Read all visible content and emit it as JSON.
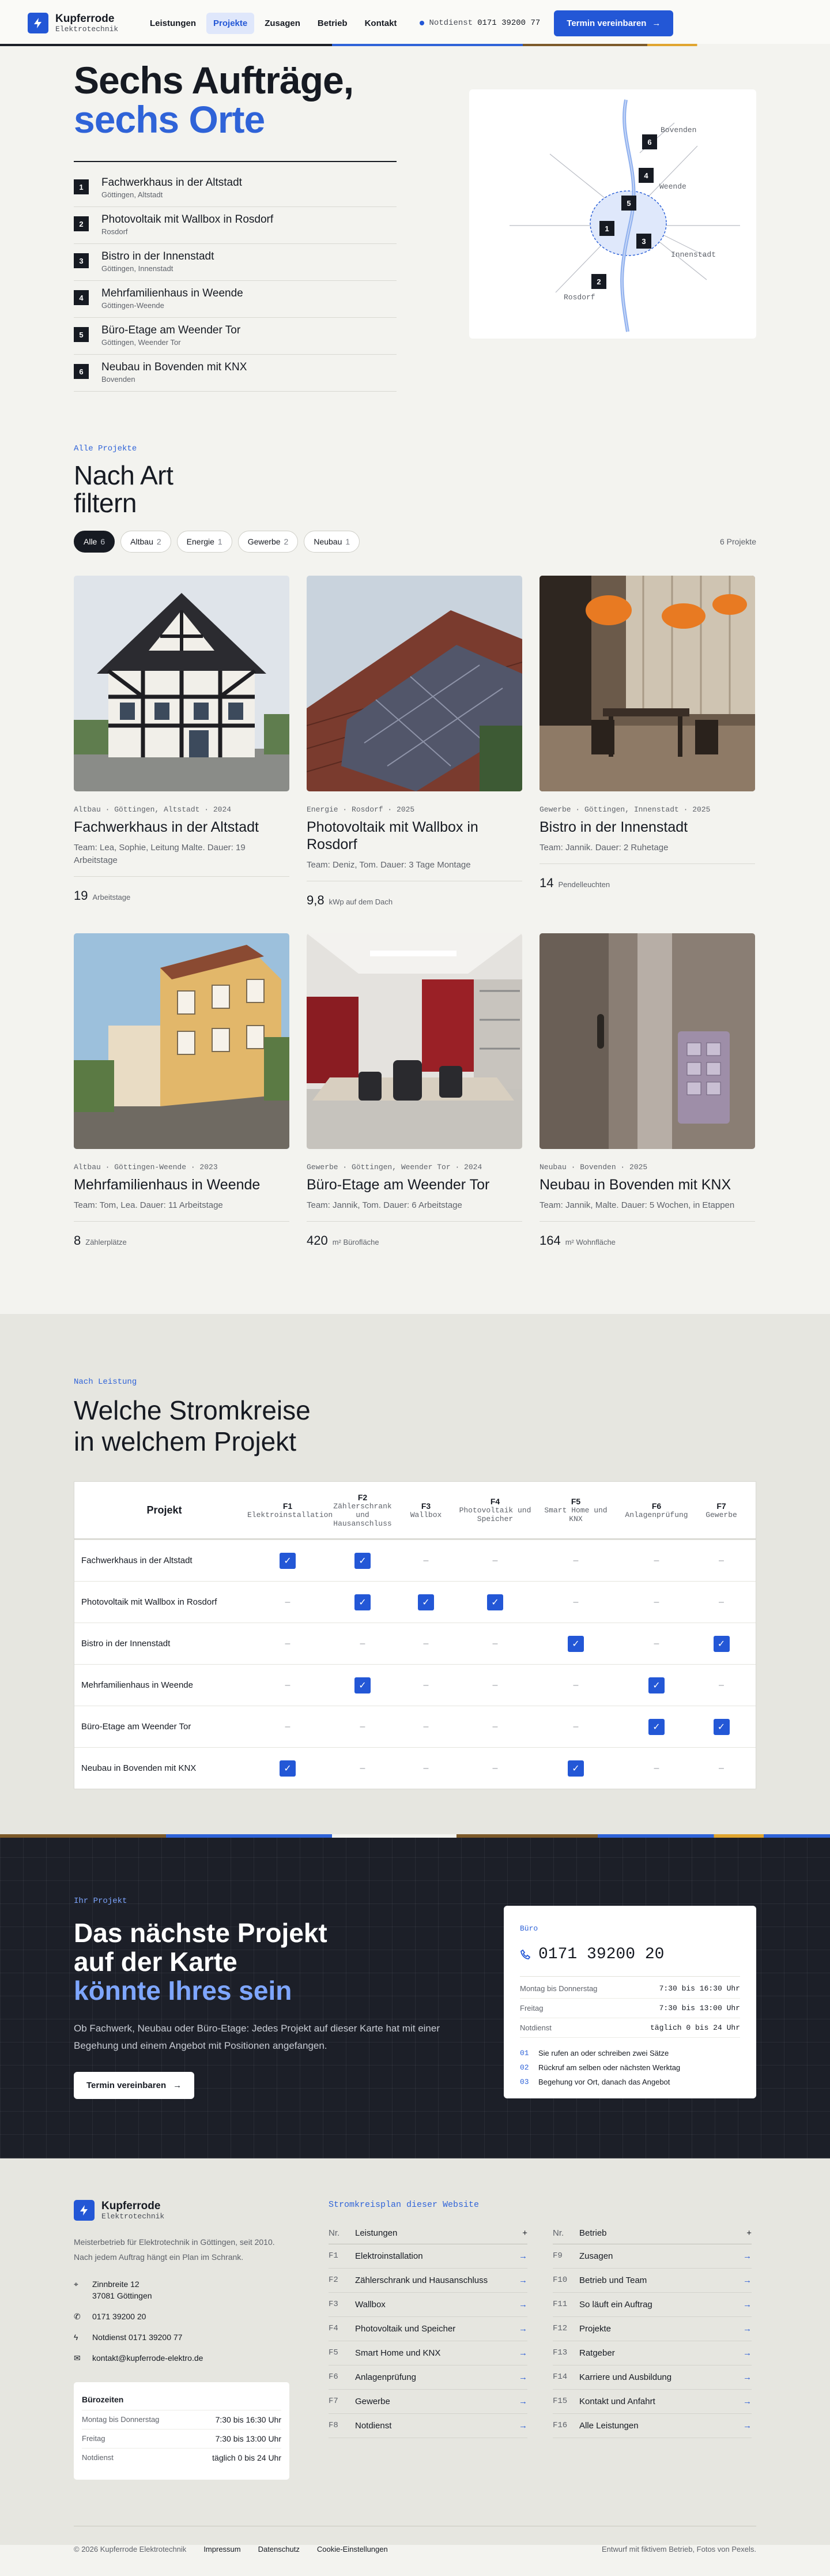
{
  "header": {
    "brand": "Kupferrode",
    "brand_sub": "Elektrotechnik",
    "nav": [
      "Leistungen",
      "Projekte",
      "Zusagen",
      "Betrieb",
      "Kontakt"
    ],
    "emergency_label": "Notdienst",
    "emergency_phone": "0171 39200 77",
    "cta": "Termin vereinbaren",
    "cta_icon": "arrow-right-icon"
  },
  "hero": {
    "title_1": "Sechs Aufträge,",
    "title_2": "sechs Orte",
    "projects": [
      {
        "no": "1",
        "title": "Fachwerkhaus in der Altstadt",
        "place": "Göttingen, Altstadt"
      },
      {
        "no": "2",
        "title": "Photovoltaik mit Wallbox in Rosdorf",
        "place": "Rosdorf"
      },
      {
        "no": "3",
        "title": "Bistro in der Innenstadt",
        "place": "Göttingen, Innenstadt"
      },
      {
        "no": "4",
        "title": "Mehrfamilienhaus in Weende",
        "place": "Göttingen-Weende"
      },
      {
        "no": "5",
        "title": "Büro-Etage am Weender Tor",
        "place": "Göttingen, Weender Tor"
      },
      {
        "no": "6",
        "title": "Neubau in Bovenden mit KNX",
        "place": "Bovenden"
      }
    ],
    "map_labels": {
      "bovenden": "Bovenden",
      "weende": "Weende",
      "innenstadt": "Innenstadt",
      "rosdorf": "Rosdorf"
    }
  },
  "filter": {
    "eyebrow": "Alle Projekte",
    "title_1": "Nach Art",
    "title_2": "filtern",
    "chips": [
      {
        "label": "Alle",
        "count": "6"
      },
      {
        "label": "Altbau",
        "count": "2"
      },
      {
        "label": "Energie",
        "count": "1"
      },
      {
        "label": "Gewerbe",
        "count": "2"
      },
      {
        "label": "Neubau",
        "count": "1"
      }
    ],
    "total": "6 Projekte"
  },
  "cards": [
    {
      "meta": "Altbau · Göttingen, Altstadt · 2024",
      "title": "Fachwerkhaus in der Altstadt",
      "team": "Team: Lea, Sophie, Leitung Malte. Dauer: 19 Arbeitstage",
      "kpi": "19",
      "unit": "Arbeitstage"
    },
    {
      "meta": "Energie · Rosdorf · 2025",
      "title": "Photovoltaik mit Wallbox in Rosdorf",
      "team": "Team: Deniz, Tom. Dauer: 3 Tage Montage",
      "kpi": "9,8",
      "unit": "kWp auf dem Dach"
    },
    {
      "meta": "Gewerbe · Göttingen, Innenstadt · 2025",
      "title": "Bistro in der Innenstadt",
      "team": "Team: Jannik. Dauer: 2 Ruhetage",
      "kpi": "14",
      "unit": "Pendelleuchten"
    },
    {
      "meta": "Altbau · Göttingen-Weende · 2023",
      "title": "Mehrfamilienhaus in Weende",
      "team": "Team: Tom, Lea. Dauer: 11 Arbeitstage",
      "kpi": "8",
      "unit": "Zählerplätze"
    },
    {
      "meta": "Gewerbe · Göttingen, Weender Tor · 2024",
      "title": "Büro-Etage am Weender Tor",
      "team": "Team: Jannik, Tom. Dauer: 6 Arbeitstage",
      "kpi": "420",
      "unit": "m² Bürofläche"
    },
    {
      "meta": "Neubau · Bovenden · 2025",
      "title": "Neubau in Bovenden mit KNX",
      "team": "Team: Jannik, Malte. Dauer: 5 Wochen, in Etappen",
      "kpi": "164",
      "unit": "m² Wohnfläche"
    }
  ],
  "matrix": {
    "eyebrow": "Nach Leistung",
    "title_1": "Welche Stromkreise",
    "title_2": "in welchem Projekt",
    "col_project": "Projekt",
    "cols": [
      {
        "k": "F1",
        "l": "Elektroinstallation"
      },
      {
        "k": "F2",
        "l": "Zählerschrank und Hausanschluss"
      },
      {
        "k": "F3",
        "l": "Wallbox"
      },
      {
        "k": "F4",
        "l": "Photovoltaik und Speicher"
      },
      {
        "k": "F5",
        "l": "Smart Home und KNX"
      },
      {
        "k": "F6",
        "l": "Anlagenprüfung"
      },
      {
        "k": "F7",
        "l": "Gewerbe"
      }
    ],
    "rows": [
      {
        "name": "Fachwerkhaus in der Altstadt",
        "v": [
          1,
          1,
          0,
          0,
          0,
          0,
          0
        ]
      },
      {
        "name": "Photovoltaik mit Wallbox in Rosdorf",
        "v": [
          0,
          1,
          1,
          1,
          0,
          0,
          0
        ]
      },
      {
        "name": "Bistro in der Innenstadt",
        "v": [
          0,
          0,
          0,
          0,
          1,
          0,
          1
        ]
      },
      {
        "name": "Mehrfamilienhaus in Weende",
        "v": [
          0,
          1,
          0,
          0,
          0,
          1,
          0
        ]
      },
      {
        "name": "Büro-Etage am Weender Tor",
        "v": [
          0,
          0,
          0,
          0,
          0,
          1,
          1
        ]
      },
      {
        "name": "Neubau in Bovenden mit KNX",
        "v": [
          1,
          0,
          0,
          0,
          1,
          0,
          0
        ]
      }
    ],
    "empty": "–",
    "check": "✓"
  },
  "cta": {
    "eyebrow": "Ihr Projekt",
    "title_1": "Das nächste Projekt",
    "title_2": "auf der Karte",
    "title_3": "könnte Ihres sein",
    "text": "Ob Fachwerk, Neubau oder Büro-Etage: Jedes Projekt auf dieser Karte hat mit einer Begehung und einem Angebot mit Positionen angefangen.",
    "button": "Termin vereinbaren",
    "card": {
      "label": "Büro",
      "phone": "0171 39200 20",
      "hours": [
        {
          "d": "Montag bis Donnerstag",
          "t": "7:30 bis 16:30 Uhr"
        },
        {
          "d": "Freitag",
          "t": "7:30 bis 13:00 Uhr"
        },
        {
          "d": "Notdienst",
          "t": "täglich 0 bis 24 Uhr"
        }
      ],
      "steps": [
        {
          "n": "01",
          "t": "Sie rufen an oder schreiben zwei Sätze"
        },
        {
          "n": "02",
          "t": "Rückruf am selben oder nächsten Werktag"
        },
        {
          "n": "03",
          "t": "Begehung vor Ort, danach das Angebot"
        }
      ]
    }
  },
  "footer": {
    "brand": "Kupferrode",
    "brand_sub": "Elektrotechnik",
    "desc": "Meisterbetrieb für Elektrotechnik in Göttingen, seit 2010. Nach jedem Auftrag hängt ein Plan im Schrank.",
    "address_1": "Zinnbreite 12",
    "address_2": "37081 Göttingen",
    "phone": "0171 39200 20",
    "emergency": "Notdienst 0171 39200 77",
    "email": "kontakt@kupferrode-elektro.de",
    "hours_title": "Bürozeiten",
    "hours": [
      {
        "d": "Montag bis Donnerstag",
        "t": "7:30 bis 16:30 Uhr"
      },
      {
        "d": "Freitag",
        "t": "7:30 bis 13:00 Uhr"
      },
      {
        "d": "Notdienst",
        "t": "täglich 0 bis 24 Uhr"
      }
    ],
    "sitemap_title": "Stromkreisplan dieser Website",
    "col1_k": "Nr.",
    "col1_h": "Leistungen",
    "col2_k": "Nr.",
    "col2_h": "Betrieb",
    "col1": [
      {
        "k": "F1",
        "l": "Elektroinstallation"
      },
      {
        "k": "F2",
        "l": "Zählerschrank und Hausanschluss"
      },
      {
        "k": "F3",
        "l": "Wallbox"
      },
      {
        "k": "F4",
        "l": "Photovoltaik und Speicher"
      },
      {
        "k": "F5",
        "l": "Smart Home und KNX"
      },
      {
        "k": "F6",
        "l": "Anlagenprüfung"
      },
      {
        "k": "F7",
        "l": "Gewerbe"
      },
      {
        "k": "F8",
        "l": "Notdienst"
      }
    ],
    "col2": [
      {
        "k": "F9",
        "l": "Zusagen"
      },
      {
        "k": "F10",
        "l": "Betrieb und Team"
      },
      {
        "k": "F11",
        "l": "So läuft ein Auftrag"
      },
      {
        "k": "F12",
        "l": "Projekte"
      },
      {
        "k": "F13",
        "l": "Ratgeber"
      },
      {
        "k": "F14",
        "l": "Karriere und Ausbildung"
      },
      {
        "k": "F15",
        "l": "Kontakt und Anfahrt"
      },
      {
        "k": "F16",
        "l": "Alle Leistungen"
      }
    ],
    "copyright": "© 2026 Kupferrode Elektrotechnik",
    "links": [
      "Impressum",
      "Datenschutz",
      "Cookie-Einstellungen"
    ],
    "credit": "Entwurf mit fiktivem Betrieb, Fotos von Pexels."
  }
}
